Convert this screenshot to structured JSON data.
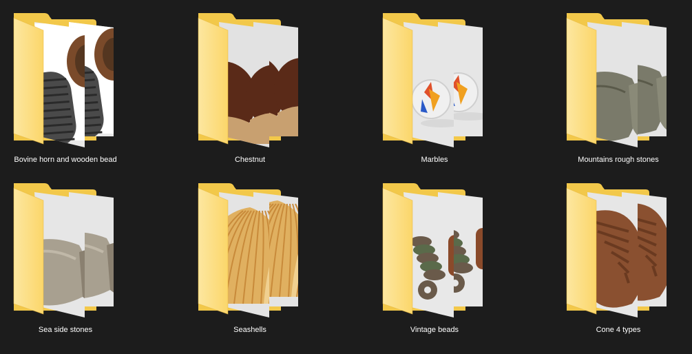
{
  "window": {
    "view": "Large icons"
  },
  "folders": [
    {
      "label": "Bovine horn and wooden bead",
      "thumbnail": "bovine-horn-and-wooden-bead-thumbnail",
      "palette": {
        "bg": "#e8e8e8",
        "obj1": "#4a4a4a",
        "obj2": "#7a4a2a",
        "obj3": "#3a2a1a"
      }
    },
    {
      "label": "Chestnut",
      "thumbnail": "chestnut-thumbnail",
      "palette": {
        "bg": "#e2e2e2",
        "obj1": "#5a2a18",
        "obj2": "#7a3a20",
        "obj3": "#c8a070"
      }
    },
    {
      "label": "Marbles",
      "thumbnail": "marble-thumbnail",
      "palette": {
        "bg": "#e6e6e6",
        "obj1": "#f0f0f0",
        "obj2": "#e0502a",
        "obj3": "#f0a020"
      }
    },
    {
      "label": "Mountains rough stones",
      "thumbnail": "rough-stones-thumbnail",
      "palette": {
        "bg": "#e4e4e4",
        "obj1": "#7a7a6a",
        "obj2": "#8a8a78",
        "obj3": "#5a5a4a"
      }
    },
    {
      "label": "Sea side stones",
      "thumbnail": "sea-stones-thumbnail",
      "palette": {
        "bg": "#e6e6e6",
        "obj1": "#a8a090",
        "obj2": "#8a8070",
        "obj3": "#c0b8a8"
      }
    },
    {
      "label": "Seashells",
      "thumbnail": "seashells-thumbnail",
      "palette": {
        "bg": "#e4e4e4",
        "obj1": "#e0b060",
        "obj2": "#c88a3a",
        "obj3": "#f0d090"
      }
    },
    {
      "label": "Vintage beads",
      "thumbnail": "vintage-beads-thumbnail",
      "palette": {
        "bg": "#e8e8e8",
        "obj1": "#6a5a4a",
        "obj2": "#8a4a2a",
        "obj3": "#5a6a4a"
      }
    },
    {
      "label": "Cone 4 types",
      "thumbnail": "pine-cone-thumbnail",
      "palette": {
        "bg": "#e6e6e6",
        "obj1": "#8a5030",
        "obj2": "#6a3a20",
        "obj3": "#b07a4a"
      }
    }
  ],
  "colors": {
    "background": "#1c1c1c",
    "folder_back": "#f2c84a",
    "folder_front": "#fbd66a",
    "folder_front_light": "#fde7a0",
    "caption": "#ffffff"
  }
}
